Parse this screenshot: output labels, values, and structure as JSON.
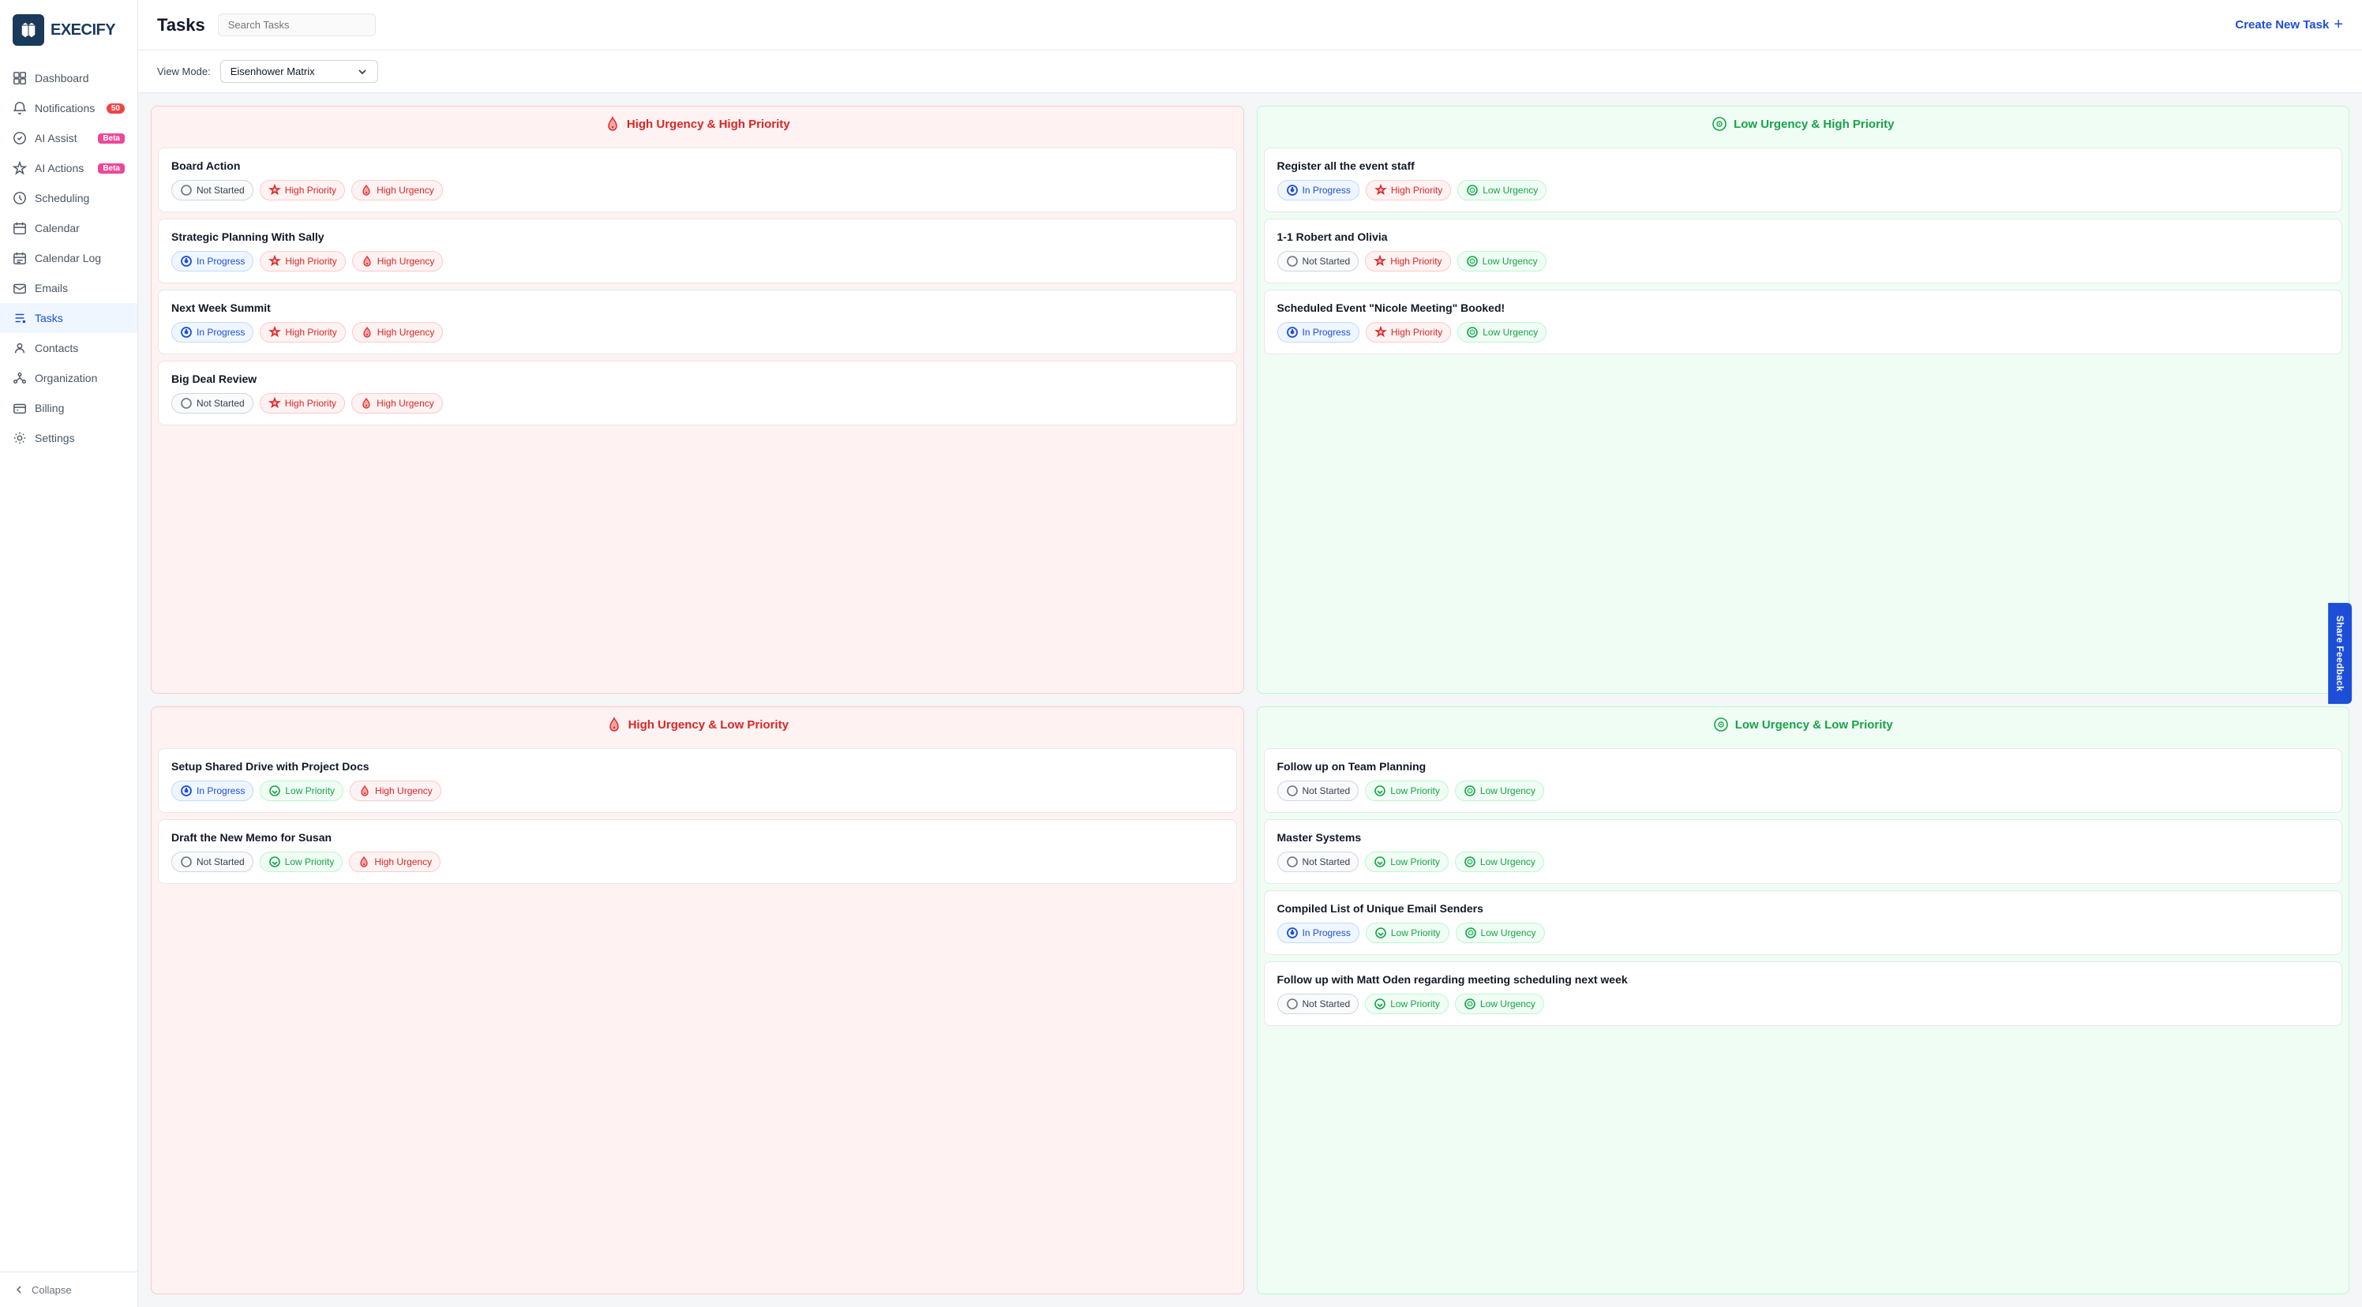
{
  "app": {
    "logo_letter": "E",
    "logo_text": "XECIFY"
  },
  "sidebar": {
    "items": [
      {
        "id": "dashboard",
        "label": "Dashboard",
        "icon": "dashboard-icon",
        "badge": null,
        "active": false
      },
      {
        "id": "notifications",
        "label": "Notifications",
        "icon": "bell-icon",
        "badge": "50",
        "badge_type": "count",
        "active": false
      },
      {
        "id": "ai-assist",
        "label": "AI Assist",
        "icon": "ai-icon",
        "badge": "Beta",
        "badge_type": "beta",
        "active": false
      },
      {
        "id": "ai-actions",
        "label": "AI Actions",
        "icon": "ai-actions-icon",
        "badge": "Beta",
        "badge_type": "beta",
        "active": false
      },
      {
        "id": "scheduling",
        "label": "Scheduling",
        "icon": "scheduling-icon",
        "badge": null,
        "active": false
      },
      {
        "id": "calendar",
        "label": "Calendar",
        "icon": "calendar-icon",
        "badge": null,
        "active": false
      },
      {
        "id": "calendar-log",
        "label": "Calendar Log",
        "icon": "calendar-log-icon",
        "badge": null,
        "active": false
      },
      {
        "id": "emails",
        "label": "Emails",
        "icon": "email-icon",
        "badge": null,
        "active": false
      },
      {
        "id": "tasks",
        "label": "Tasks",
        "icon": "tasks-icon",
        "badge": null,
        "active": true
      },
      {
        "id": "contacts",
        "label": "Contacts",
        "icon": "contacts-icon",
        "badge": null,
        "active": false
      },
      {
        "id": "organization",
        "label": "Organization",
        "icon": "org-icon",
        "badge": null,
        "active": false
      },
      {
        "id": "billing",
        "label": "Billing",
        "icon": "billing-icon",
        "badge": null,
        "active": false
      },
      {
        "id": "settings",
        "label": "Settings",
        "icon": "settings-icon",
        "badge": null,
        "active": false
      }
    ],
    "collapse_label": "Collapse"
  },
  "topbar": {
    "title": "Tasks",
    "search_placeholder": "Search Tasks",
    "create_button_label": "Create New Task"
  },
  "toolbar": {
    "view_mode_label": "View Mode:",
    "view_mode_value": "Eisenhower Matrix"
  },
  "matrix": {
    "quadrants": [
      {
        "id": "huhp",
        "type": "high-urgency-high-priority",
        "header": "High Urgency & High Priority",
        "header_icon": "fire-icon",
        "tasks": [
          {
            "title": "Board Action",
            "status": "Not Started",
            "status_type": "not-started",
            "priority": "High Priority",
            "priority_type": "high-priority",
            "urgency": "High Urgency",
            "urgency_type": "high-urgency"
          },
          {
            "title": "Strategic Planning With Sally",
            "status": "In Progress",
            "status_type": "in-progress",
            "priority": "High Priority",
            "priority_type": "high-priority",
            "urgency": "High Urgency",
            "urgency_type": "high-urgency"
          },
          {
            "title": "Next Week Summit",
            "status": "In Progress",
            "status_type": "in-progress",
            "priority": "High Priority",
            "priority_type": "high-priority",
            "urgency": "High Urgency",
            "urgency_type": "high-urgency"
          },
          {
            "title": "Big Deal Review",
            "status": "Not Started",
            "status_type": "not-started",
            "priority": "High Priority",
            "priority_type": "high-priority",
            "urgency": "High Urgency",
            "urgency_type": "high-urgency"
          }
        ]
      },
      {
        "id": "luhp",
        "type": "low-urgency-high-priority",
        "header": "Low Urgency & High Priority",
        "header_icon": "target-icon",
        "tasks": [
          {
            "title": "Register all the event staff",
            "status": "In Progress",
            "status_type": "in-progress",
            "priority": "High Priority",
            "priority_type": "high-priority",
            "urgency": "Low Urgency",
            "urgency_type": "low-urgency"
          },
          {
            "title": "1-1 Robert and Olivia",
            "status": "Not Started",
            "status_type": "not-started",
            "priority": "High Priority",
            "priority_type": "high-priority",
            "urgency": "Low Urgency",
            "urgency_type": "low-urgency"
          },
          {
            "title": "Scheduled Event \"Nicole Meeting\" Booked!",
            "status": "In Progress",
            "status_type": "in-progress",
            "priority": "High Priority",
            "priority_type": "high-priority",
            "urgency": "Low Urgency",
            "urgency_type": "low-urgency"
          }
        ]
      },
      {
        "id": "hulp",
        "type": "high-urgency-low-priority",
        "header": "High Urgency & Low Priority",
        "header_icon": "fire-icon",
        "tasks": [
          {
            "title": "Setup Shared Drive with Project Docs",
            "status": "In Progress",
            "status_type": "in-progress",
            "priority": "Low Priority",
            "priority_type": "low-priority",
            "urgency": "High Urgency",
            "urgency_type": "high-urgency"
          },
          {
            "title": "Draft the New Memo for Susan",
            "status": "Not Started",
            "status_type": "not-started",
            "priority": "Low Priority",
            "priority_type": "low-priority",
            "urgency": "High Urgency",
            "urgency_type": "high-urgency"
          }
        ]
      },
      {
        "id": "lulp",
        "type": "low-urgency-low-priority",
        "header": "Low Urgency & Low Priority",
        "header_icon": "target-icon",
        "tasks": [
          {
            "title": "Follow up on Team Planning",
            "status": "Not Started",
            "status_type": "not-started",
            "priority": "Low Priority",
            "priority_type": "low-priority",
            "urgency": "Low Urgency",
            "urgency_type": "low-urgency"
          },
          {
            "title": "Master Systems",
            "status": "Not Started",
            "status_type": "not-started",
            "priority": "Low Priority",
            "priority_type": "low-priority",
            "urgency": "Low Urgency",
            "urgency_type": "low-urgency"
          },
          {
            "title": "Compiled List of Unique Email Senders",
            "status": "In Progress",
            "status_type": "in-progress",
            "priority": "Low Priority",
            "priority_type": "low-priority",
            "urgency": "Low Urgency",
            "urgency_type": "low-urgency"
          },
          {
            "title": "Follow up with Matt Oden regarding meeting scheduling next week",
            "status": "Not Started",
            "status_type": "not-started",
            "priority": "Low Priority",
            "priority_type": "low-priority",
            "urgency": "Low Urgency",
            "urgency_type": "low-urgency"
          }
        ]
      }
    ]
  },
  "feedback": {
    "label": "Share Feedback"
  }
}
